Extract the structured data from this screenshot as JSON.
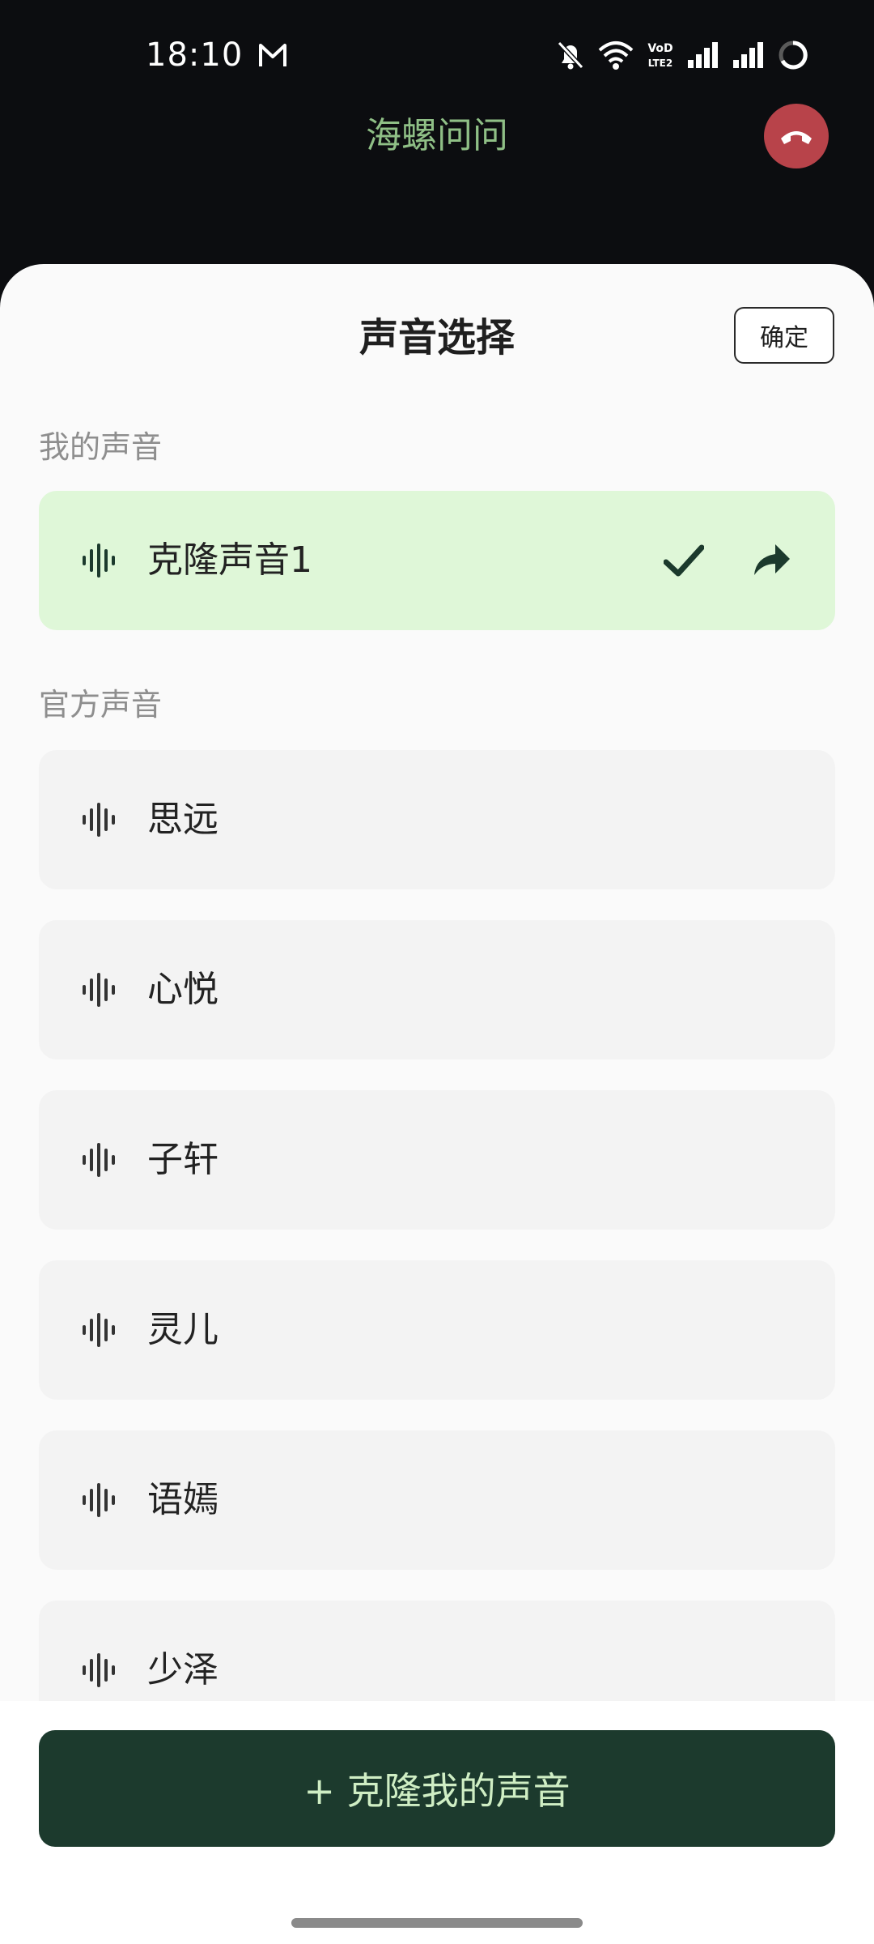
{
  "status_bar": {
    "time": "18:10",
    "network_label": "VoLTE2"
  },
  "app": {
    "title": "海螺问问"
  },
  "sheet": {
    "title": "声音选择",
    "confirm_label": "确定",
    "my_voices_label": "我的声音",
    "official_voices_label": "官方声音",
    "my_voices": [
      {
        "name": "克隆声音1",
        "selected": true
      }
    ],
    "official_voices": [
      {
        "name": "思远"
      },
      {
        "name": "心悦"
      },
      {
        "name": "子轩"
      },
      {
        "name": "灵儿"
      },
      {
        "name": "语嫣"
      },
      {
        "name": "少泽"
      }
    ]
  },
  "footer": {
    "clone_button_label": "+ 克隆我的声音"
  },
  "colors": {
    "accent_dark_green": "#1c3a2d",
    "selected_card": "#dff7d8",
    "hangup_red": "#b8434a",
    "title_green": "#8fbf86"
  }
}
